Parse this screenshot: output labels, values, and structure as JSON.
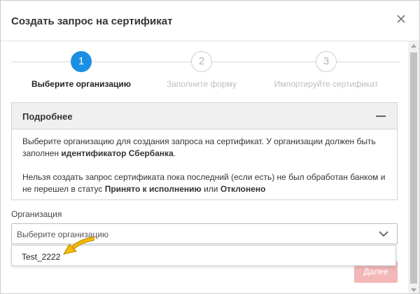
{
  "dialog": {
    "title": "Создать запрос на сертификат",
    "close_icon": "close-icon"
  },
  "stepper": {
    "steps": [
      {
        "number": "1",
        "label": "Выберите организацию",
        "state": "active"
      },
      {
        "number": "2",
        "label": "Заполните форму",
        "state": "inactive"
      },
      {
        "number": "3",
        "label": "Импортируйте сертификат",
        "state": "inactive"
      }
    ]
  },
  "details": {
    "title": "Подробнее",
    "p1_text": "Выберите организацию для создания запроса на сертификат. У организации должен быть заполнен ",
    "p1_bold": "идентификатор Сбербанка",
    "p1_end": ".",
    "p2_text": "Нельзя создать запрос сертификата пока последний (если есть) не был обработан банком и не перешел в статус ",
    "p2_bold1": "Принято к исполнению",
    "p2_mid": " или ",
    "p2_bold2": "Отклонено"
  },
  "organization": {
    "label": "Организация",
    "placeholder": "Выберите организацию",
    "options": [
      "Test_2222"
    ]
  },
  "footer": {
    "next_label": "Далее"
  },
  "colors": {
    "accent": "#1a8fe3",
    "next_disabled": "#f2b7b7",
    "pointer": "#f5b800"
  }
}
